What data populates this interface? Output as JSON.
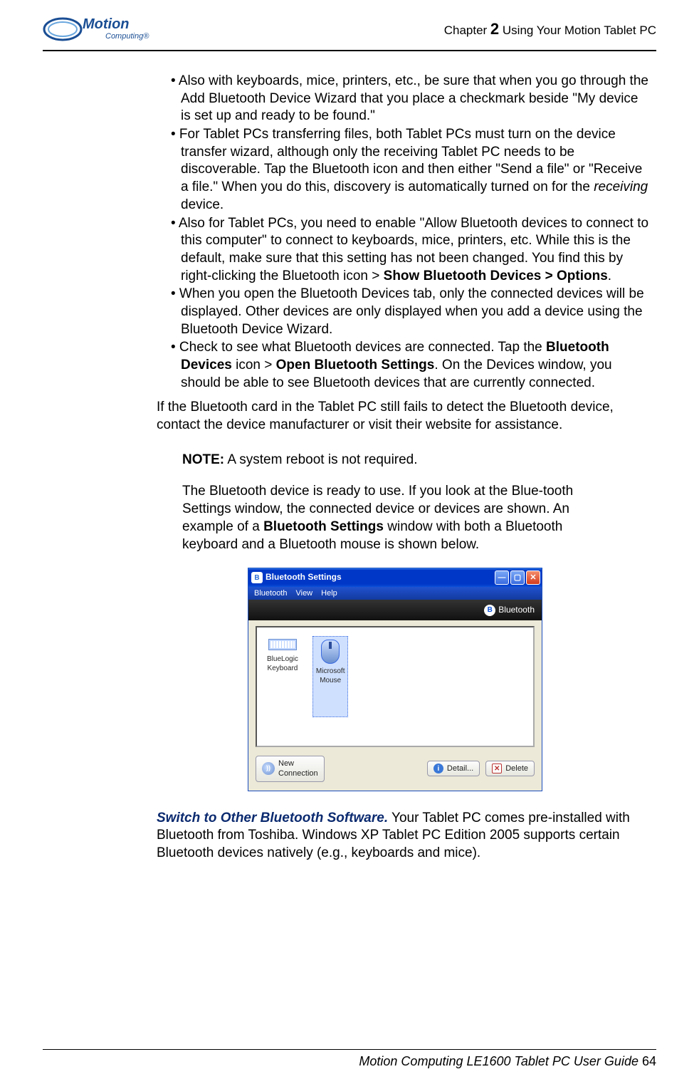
{
  "header": {
    "brand_top": "Motion",
    "brand_sub": "Computing",
    "chapter_label_pre": "Chapter ",
    "chapter_number": "2",
    "chapter_label_post": "  Using Your Motion Tablet PC"
  },
  "bullets": {
    "b1": "• Also with keyboards, mice, printers, etc., be sure that when you go through the Add Bluetooth Device Wizard that you place a checkmark beside \"My device is set up and ready to be found.\"",
    "b2a": "• For Tablet PCs transferring files, both Tablet PCs must turn on the device transfer wizard, although only the receiving Tablet PC needs to be discoverable. Tap the Bluetooth icon and then either \"Send a file\" or \"Receive a file.\" When you do this, discovery is automatically turned on for the ",
    "b2_italic": "receiving",
    "b2b": " device.",
    "b3a": "• Also for Tablet PCs, you need to enable \"Allow Bluetooth devices to connect to this computer\" to connect to keyboards, mice, printers, etc. While this is the default, make sure that this setting has not been changed. You find this by right-clicking the Bluetooth icon > ",
    "b3_bold": "Show Bluetooth Devices > Options",
    "b3b": ".",
    "b4": "• When you open the Bluetooth Devices tab, only the connected devices will be displayed. Other devices are only displayed when you add a device using the Bluetooth Device Wizard.",
    "b5a": "• Check to see what Bluetooth devices are connected. Tap the ",
    "b5_bold1": "Bluetooth Devices",
    "b5b": " icon > ",
    "b5_bold2": "Open Bluetooth Settings",
    "b5c": ". On the Devices window, you should be able to see Bluetooth devices that are currently connected."
  },
  "after_para": "If the Bluetooth card in the Tablet PC still fails to detect the Bluetooth device, contact the device manufacturer or visit their website for assistance.",
  "note": {
    "label": "NOTE:",
    "text": " A system reboot is not required.",
    "body_a": "The Bluetooth device is ready to use. If you look at the Blue-tooth Settings window, the connected device or devices are shown. An example of a ",
    "body_bold": "Bluetooth Settings",
    "body_b": " window with both a Bluetooth keyboard and a Bluetooth mouse is shown below."
  },
  "window": {
    "title": "Bluetooth Settings",
    "menu": {
      "m1": "Bluetooth",
      "m2": "View",
      "m3": "Help"
    },
    "brand": "Bluetooth",
    "dev1_l1": "BlueLogic",
    "dev1_l2": "Keyboard",
    "dev2_l1": "Microsoft",
    "dev2_l2": "Mouse",
    "btn_new_l1": "New",
    "btn_new_l2": "Connection",
    "btn_detail": "Detail...",
    "btn_delete": "Delete"
  },
  "switch": {
    "title": "Switch to Other Bluetooth Software.",
    "text": " Your Tablet PC comes pre-installed with Bluetooth from Toshiba. Windows XP Tablet PC Edition 2005 supports certain Bluetooth devices natively (e.g., keyboards and mice)."
  },
  "footer": {
    "text": "Motion Computing LE1600 Tablet PC User Guide ",
    "page": "64"
  }
}
